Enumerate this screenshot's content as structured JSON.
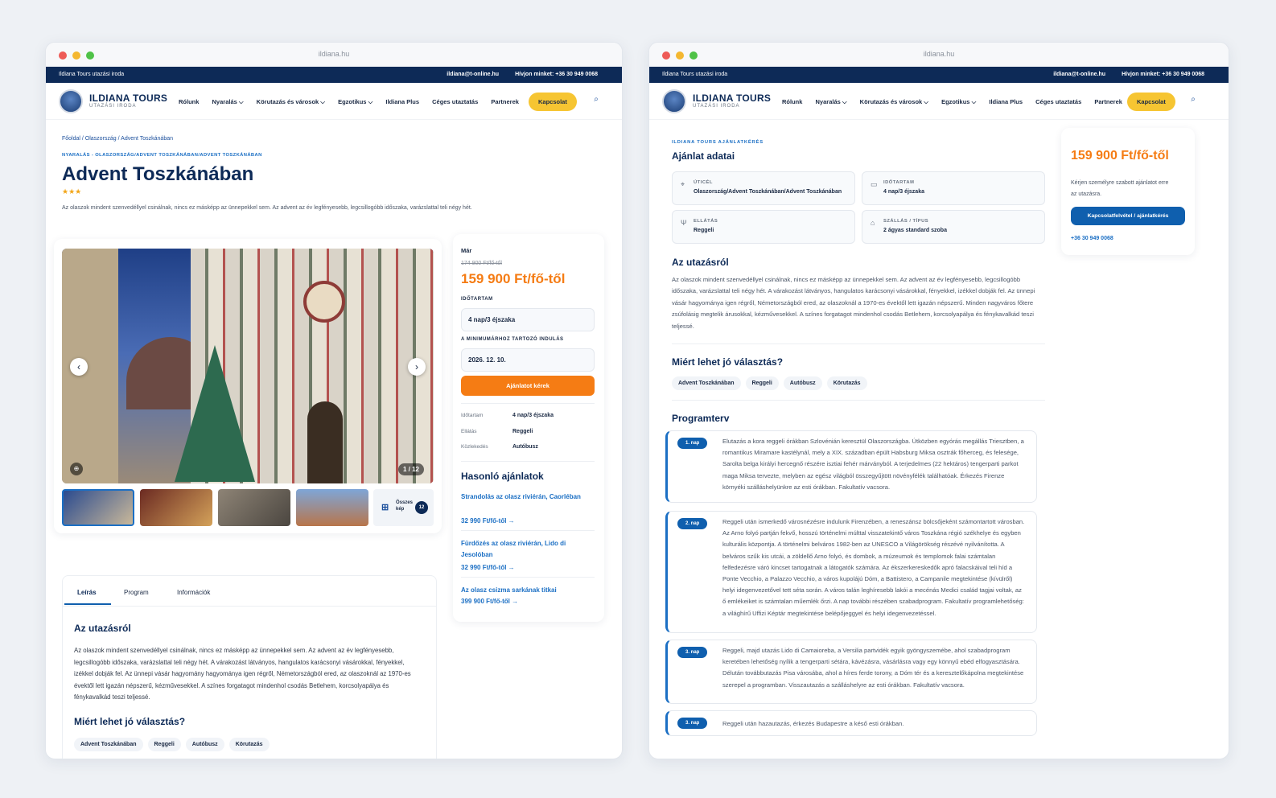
{
  "window1": {
    "url": "ildiana.hu",
    "topbar": {
      "left": "Ildiana Tours utazási iroda",
      "email": "ildiana@t-online.hu",
      "phone": "Hívjon minket: +36 30 949 0068"
    },
    "brand": {
      "name": "ILDIANA TOURS",
      "sub": "UTAZÁSI IRODA"
    },
    "menu": [
      "Rólunk",
      "Nyaralás ⌵",
      "Körutazás és városok ⌵",
      "Egzotikus ⌵",
      "Ildiana Plus",
      "Céges utaztatás",
      "Partnerek"
    ],
    "cta": "Kapcsolat",
    "breadcrumb": "Főoldal / Olaszország / Advent Toszkánában",
    "category": "NYARALÁS - OLASZORSZÁG/ADVENT TOSZKÁNÁBAN/ADVENT TOSZKÁNÁBAN",
    "title": "Advent Toszkánában",
    "stars": "★★★",
    "intro": "Az olaszok mindent szenvedéllyel csinálnak, nincs ez másképp az ünnepekkel sem. Az advent az év legfényesebb, legcsillogóbb időszaka, varázslattal teli négy hét.",
    "gallery": {
      "counter": "1 / 12",
      "all_label1": "Összes",
      "all_label2": "kép",
      "all_count": "12"
    },
    "booking": {
      "from": "Már",
      "old_price": "174 900 Ft/fő-től",
      "price": "159 900 Ft/fő-től",
      "duration_label": "IDŐTARTAM",
      "duration": "4 nap/3 éjszaka",
      "date_label": "A MINIMUMÁRHOZ TARTOZÓ INDULÁS",
      "date": "2026. 12. 10.",
      "button": "Ajánlatot kérek",
      "facts": [
        {
          "k": "Időtartam",
          "v": "4 nap/3 éjszaka"
        },
        {
          "k": "Ellátás",
          "v": "Reggeli"
        },
        {
          "k": "Közlekedés",
          "v": "Autóbusz"
        }
      ]
    },
    "similar": {
      "title": "Hasonló ajánlatok",
      "items": [
        {
          "name": "Strandolás az olasz riviérán, Caorléban",
          "price": "32 990 Ft/fő-től →"
        },
        {
          "name": "Fürdőzés az olasz riviérán, Lido di Jesolóban",
          "price": "32 990 Ft/fő-től →"
        },
        {
          "name": "Az olasz csizma sarkának titkai",
          "price": "399 900 Ft/fő-től →"
        }
      ]
    },
    "tabs": [
      "Leírás",
      "Program",
      "Információk"
    ],
    "about_title": "Az utazásról",
    "about_text": "Az olaszok mindent szenvedéllyel csinálnak, nincs ez másképp az ünnepekkel sem. Az advent az év legfényesebb, legcsillogóbb időszaka, varázslattal teli négy hét. A várakozást látványos, hangulatos karácsonyi vásárokkal, fényekkel, izékkel dobják fel. Az ünnepi vásár hagyomány hagyománya igen régről, Németországból ered, az olaszoknál az 1970-es évektől lett igazán népszerű, kézművesekkel. A színes forgatagot mindenhol csodás Betlehem, korcsolyapálya és fénykavalkád teszi teljessé.",
    "why_title": "Miért lehet jó választás?",
    "chips": [
      "Advent Toszkánában",
      "Reggeli",
      "Autóbusz",
      "Körutazás"
    ]
  },
  "window2": {
    "url": "ildiana.hu",
    "topbar": {
      "left": "Ildiana Tours utazási iroda",
      "email": "ildiana@t-online.hu",
      "phone": "Hívjon minket: +36 30 949 0068"
    },
    "brand": {
      "name": "ILDIANA TOURS",
      "sub": "UTAZÁSI IRODA"
    },
    "menu": [
      "Rólunk",
      "Nyaralás ⌵",
      "Körutazás és városok ⌵",
      "Egzotikus ⌵",
      "Ildiana Plus",
      "Céges utaztatás",
      "Partnerek"
    ],
    "cta": "Kapcsolat",
    "eyebrow": "ILDIANA TOURS AJÁNLATKÉRÉS",
    "offer_title": "Ajánlat adatai",
    "info": [
      {
        "label": "ÚTICÉL",
        "value": "Olaszország/Advent Toszkánában/Advent Toszkánában",
        "icon": "location-pin-icon"
      },
      {
        "label": "IDŐTARTAM",
        "value": "4 nap/3 éjszaka",
        "icon": "calendar-icon"
      },
      {
        "label": "ELLÁTÁS",
        "value": "Reggeli",
        "icon": "cutlery-icon"
      },
      {
        "label": "SZÁLLÁS / TÍPUS",
        "value": "2 ágyas standard szoba",
        "icon": "bed-icon"
      }
    ],
    "about_title": "Az utazásról",
    "about_text": "Az olaszok mindent szenvedéllyel csinálnak, nincs ez másképp az ünnepekkel sem. Az advent az év legfényesebb, legcsillogóbb időszaka, varázslattal teli négy hét. A várakozást látványos, hangulatos karácsonyi vásárokkal, fényekkel, izékkel dobják fel. Az ünnepi vásár hagyománya igen régről, Németországból ered, az olaszoknál a 1970-es évektől lett igazán népszerű. Minden nagyváros főtere zsúfolásig megtelik árusokkal, kézművesekkel. A színes forgatagot mindenhol csodás Betlehem, korcsolyapálya és fénykavalkád teszi teljessé.",
    "why_title": "Miért lehet jó választás?",
    "chips": [
      "Advent Toszkánában",
      "Reggeli",
      "Autóbusz",
      "Körutazás"
    ],
    "program_title": "Programterv",
    "days": [
      {
        "badge": "1. nap",
        "text": "Elutazás a kora reggeli órákban Szlovénián keresztül Olaszországba. Útközben egyórás megállás Triesztben, a romantikus Miramare kastélynál, mely a XIX. században épült Habsburg Miksa osztrák főherceg, és felesége, Sarolta belga királyi hercegnő részére isztiai fehér márványból. A terjedelmes (22 hektáros) tengerparti parkot maga Miksa tervezte, melyben az egész világból összegyűjtött növényfélék találhatóak. Érkezés Firenze környéki szálláshelyünkre az esti órákban. Fakultatív vacsora."
      },
      {
        "badge": "2. nap",
        "text": "Reggeli után ismerkedő városnézésre indulunk Firenzében, a reneszánsz bölcsőjeként számontartott városban. Az Arno folyó partján fekvő, hosszú történelmi múlttal visszatekintő város Toszkána régió székhelye és egyben kulturális központja. A történelmi belváros 1982-ben az UNESCO a Világörökség részévé nyilvánította. A belváros szűk kis utcái, a zöldellő Arno folyó, és dombok, a múzeumok és templomok falai számtalan felfedezésre váró kincset tartogatnak a látogatók számára. Az ékszerkereskedők apró falacskáival teli híd a Ponte Vecchio, a Palazzo Vecchio, a város kupolájú Dóm, a Battistero, a Campanile megtekintése (kívülről) helyi idegenvezetővel tett séta során. A város talán leghíresebb lakói a mecénás Medici család tagjai voltak, az ő emlékeiket is számtalan műemlék őrzi. A nap további részében szabadprogram. Fakultatív programlehetőség: a világhírű Uffizi Képtár megtekintése belépőjeggyel és helyi idegenvezetéssel."
      },
      {
        "badge": "3. nap",
        "text": "Reggeli, majd utazás Lido di Camaioreba, a Versilia partvidék egyik gyöngyszemébe, ahol szabadprogram keretében lehetőség nyílik a tengerparti sétára, kávézásra, vásárlásra vagy egy könnyű ebéd elfogyasztására. Délután továbbutazás Pisa városába, ahol a híres ferde torony, a Dóm tér és a keresztelőkápolna megtekintése szerepel a programban. Visszautazás a szálláshelyre az esti órákban. Fakultatív vacsora."
      },
      {
        "badge": "3. nap",
        "text": "Reggeli után hazautazás, érkezés Budapestre a késő esti órákban."
      }
    ],
    "side": {
      "price": "159 900 Ft/fő-től",
      "text": "Kérjen személyre szabott ajánlatot erre az utazásra.",
      "button": "Kapcsolatfelvétel / ajánlatkérés",
      "phone": "+36 30 949 0068"
    }
  },
  "colors": {
    "navy": "#0d2a57",
    "accent_orange": "#f57c14",
    "accent_yellow": "#f6c532",
    "link_blue": "#1b6fc4"
  }
}
